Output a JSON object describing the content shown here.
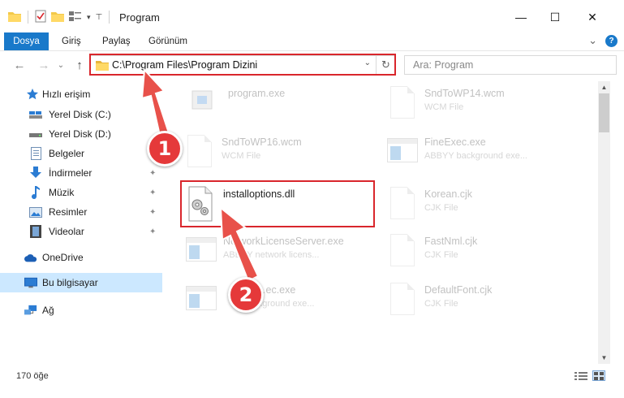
{
  "window": {
    "title": "Program",
    "minimize_glyph": "—",
    "maximize_glyph": "☐",
    "close_glyph": "✕"
  },
  "ribbon": {
    "file_tab": "Dosya",
    "tabs": [
      "Giriş",
      "Paylaş",
      "Görünüm"
    ],
    "expand_glyph": "⌄",
    "help_glyph": "?"
  },
  "nav": {
    "back_glyph": "←",
    "forward_glyph": "→",
    "recent_glyph": "⌄",
    "up_glyph": "↑",
    "address_path": "C:\\Program Files\\Program Dizini",
    "address_dropdown_glyph": "⌄",
    "refresh_glyph": "↻",
    "search_placeholder": "Ara: Program"
  },
  "sidebar": {
    "items": [
      {
        "label": "Hızlı erişim",
        "icon": "star-icon"
      },
      {
        "label": "Yerel Disk (C:)",
        "icon": "drive-icon"
      },
      {
        "label": "Yerel Disk (D:)",
        "icon": "drive-icon"
      },
      {
        "label": "Belgeler",
        "icon": "documents-icon",
        "pinned": true
      },
      {
        "label": "İndirmeler",
        "icon": "download-icon",
        "pinned": true
      },
      {
        "label": "Müzik",
        "icon": "music-icon",
        "pinned": true
      },
      {
        "label": "Resimler",
        "icon": "pictures-icon",
        "pinned": true
      },
      {
        "label": "Videolar",
        "icon": "videos-icon",
        "pinned": true
      },
      {
        "label": "OneDrive",
        "icon": "cloud-icon"
      },
      {
        "label": "Bu bilgisayar",
        "icon": "computer-icon",
        "selected": true
      },
      {
        "label": "Ağ",
        "icon": "network-icon"
      }
    ],
    "pin_glyph": "📌"
  },
  "files": [
    {
      "name": "program.exe",
      "type": "",
      "icon": "exe-icon"
    },
    {
      "name": "SndToWP14.wcm",
      "type": "WCM File",
      "icon": "document-icon"
    },
    {
      "name": "SndToWP16.wcm",
      "type": "WCM File",
      "icon": "document-icon"
    },
    {
      "name": "FineExec.exe",
      "type": "ABBYY background exe...",
      "icon": "app-window-icon"
    },
    {
      "name": "installoptions.dll",
      "type": "",
      "icon": "dll-gear-icon"
    },
    {
      "name": "Korean.cjk",
      "type": "CJK File",
      "icon": "document-icon"
    },
    {
      "name": "NetworkLicenseServer.exe",
      "type": "ABBYY network licens...",
      "icon": "app-window-icon"
    },
    {
      "name": "FastNml.cjk",
      "type": "CJK File",
      "icon": "document-icon"
    },
    {
      "name": "…ec.exe",
      "type": "…background exe...",
      "icon": "app-window-icon"
    },
    {
      "name": "DefaultFont.cjk",
      "type": "CJK File",
      "icon": "document-icon"
    }
  ],
  "status": {
    "item_count": "170 öğe"
  },
  "callouts": [
    "1",
    "2"
  ],
  "colors": {
    "accent": "#1979ca",
    "highlight_box": "#d9262c",
    "callout": "#e5393a",
    "arrow": "#e8514a",
    "selected_bg": "#cce8ff"
  }
}
